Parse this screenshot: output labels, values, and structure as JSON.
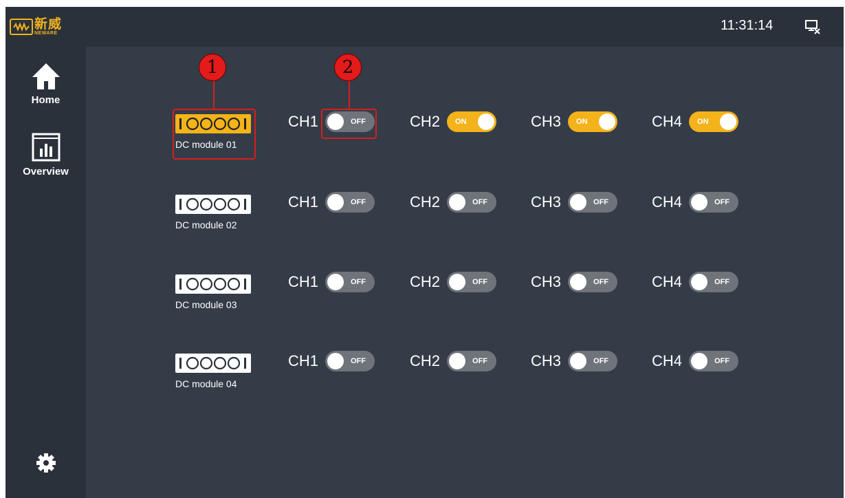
{
  "header": {
    "logo_cn": "新威",
    "logo_en": "NEWARE",
    "time": "11:31:14"
  },
  "sidebar": {
    "home_label": "Home",
    "overview_label": "Overview"
  },
  "modules": [
    {
      "label": "DC module 01",
      "active": true,
      "channels": [
        {
          "name": "CH1",
          "state": "OFF"
        },
        {
          "name": "CH2",
          "state": "ON"
        },
        {
          "name": "CH3",
          "state": "ON"
        },
        {
          "name": "CH4",
          "state": "ON"
        }
      ]
    },
    {
      "label": "DC module 02",
      "active": false,
      "channels": [
        {
          "name": "CH1",
          "state": "OFF"
        },
        {
          "name": "CH2",
          "state": "OFF"
        },
        {
          "name": "CH3",
          "state": "OFF"
        },
        {
          "name": "CH4",
          "state": "OFF"
        }
      ]
    },
    {
      "label": "DC module 03",
      "active": false,
      "channels": [
        {
          "name": "CH1",
          "state": "OFF"
        },
        {
          "name": "CH2",
          "state": "OFF"
        },
        {
          "name": "CH3",
          "state": "OFF"
        },
        {
          "name": "CH4",
          "state": "OFF"
        }
      ]
    },
    {
      "label": "DC module 04",
      "active": false,
      "channels": [
        {
          "name": "CH1",
          "state": "OFF"
        },
        {
          "name": "CH2",
          "state": "OFF"
        },
        {
          "name": "CH3",
          "state": "OFF"
        },
        {
          "name": "CH4",
          "state": "OFF"
        }
      ]
    }
  ],
  "callouts": [
    "1",
    "2"
  ],
  "colors": {
    "accent": "#f3b319",
    "background": "#343c48",
    "bar": "#2a313b",
    "toggle_off": "#6f737a",
    "callout": "#e31b1b"
  },
  "icons": {
    "home": "home-icon",
    "overview": "bar-chart-icon",
    "settings": "gear-icon",
    "network": "network-disconnected-icon"
  }
}
